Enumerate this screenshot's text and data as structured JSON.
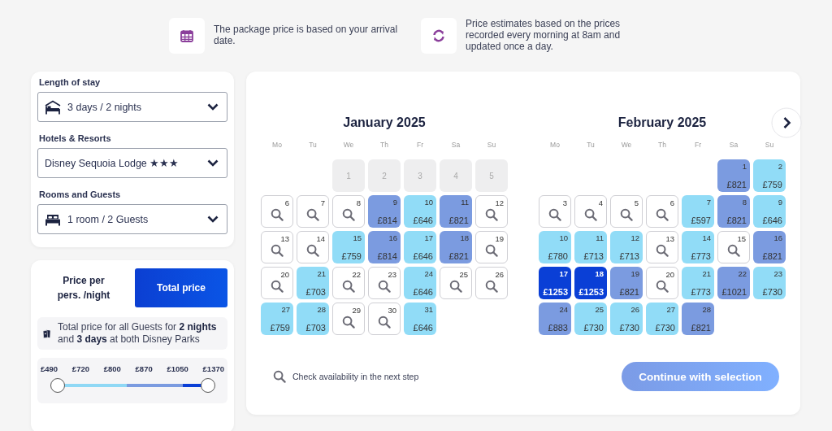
{
  "notes": [
    {
      "text": "The package price is based on your arrival date."
    },
    {
      "text": "Price estimates based on the prices recorded every morning at 8am and updated once a day."
    }
  ],
  "filters": [
    {
      "label": "Length of stay",
      "value": "3 days / 2 nights"
    },
    {
      "label": "Hotels & Resorts",
      "value": "Disney Sequoia Lodge ★★★"
    },
    {
      "label": "Rooms and Guests",
      "value": "1 room / 2 Guests"
    }
  ],
  "price_mode": [
    {
      "label": "Price per pers. /night",
      "selected": false
    },
    {
      "label": "Total price",
      "selected": true
    }
  ],
  "price_note": "Total price for all Guests for **2 nights** and **3 days** at both Disney Parks",
  "price_filter": {
    "labels": [
      "£490",
      "£720",
      "£800",
      "£870",
      "£1050",
      "£1370"
    ],
    "thumbs": [
      {
        "level": 0
      },
      {
        "level": 1
      }
    ]
  },
  "months": [
    {
      "title": "January 2025",
      "weekdays": [
        "Mo",
        "Tu",
        "We",
        "Th",
        "Fr",
        "Sa",
        "Su"
      ],
      "weeks": [
        [
          {
            "day": "1",
            "kind": "past"
          },
          {
            "day": "2",
            "kind": "past"
          },
          {
            "day": "3",
            "kind": "past"
          },
          {
            "day": "4",
            "kind": "past"
          },
          {
            "day": "5",
            "kind": "past"
          }
        ],
        [
          {
            "day": "6",
            "kind": "check"
          },
          {
            "day": "7",
            "kind": "check"
          },
          {
            "day": "8",
            "kind": "check"
          },
          {
            "day": "9",
            "kind": "priced",
            "color": "#7b9be0",
            "price": "£814"
          },
          {
            "day": "10",
            "kind": "priced",
            "color": "#91dcf7",
            "price": "£646"
          },
          {
            "day": "11",
            "kind": "priced",
            "color": "#7b9be0",
            "price": "£821"
          },
          {
            "day": "12",
            "kind": "check"
          }
        ],
        [
          {
            "day": "13",
            "kind": "check"
          },
          {
            "day": "14",
            "kind": "check"
          },
          {
            "day": "15",
            "kind": "priced",
            "color": "#91dcf7",
            "price": "£759"
          },
          {
            "day": "16",
            "kind": "priced",
            "color": "#7b9be0",
            "price": "£814"
          },
          {
            "day": "17",
            "kind": "priced",
            "color": "#91dcf7",
            "price": "£646"
          },
          {
            "day": "18",
            "kind": "priced",
            "color": "#7b9be0",
            "price": "£821"
          },
          {
            "day": "19",
            "kind": "check"
          }
        ],
        [
          {
            "day": "20",
            "kind": "check"
          },
          {
            "day": "21",
            "kind": "priced",
            "color": "#91dcf7",
            "price": "£703"
          },
          {
            "day": "22",
            "kind": "check"
          },
          {
            "day": "23",
            "kind": "check"
          },
          {
            "day": "24",
            "kind": "priced",
            "color": "#91dcf7",
            "price": "£646"
          },
          {
            "day": "25",
            "kind": "check"
          },
          {
            "day": "26",
            "kind": "check"
          }
        ],
        [
          {
            "day": "27",
            "kind": "priced",
            "color": "#91dcf7",
            "price": "£759"
          },
          {
            "day": "28",
            "kind": "priced",
            "color": "#91dcf7",
            "price": "£703"
          },
          {
            "day": "29",
            "kind": "check"
          },
          {
            "day": "30",
            "kind": "check"
          },
          {
            "day": "31",
            "kind": "priced",
            "color": "#91dcf7",
            "price": "£646"
          }
        ]
      ]
    },
    {
      "title": "February 2025",
      "weekdays": [
        "Mo",
        "Tu",
        "We",
        "Th",
        "Fr",
        "Sa",
        "Su"
      ],
      "weeks": [
        [
          {
            "day": "1",
            "kind": "priced",
            "color": "#7b9be0",
            "price": "£821"
          },
          {
            "day": "2",
            "kind": "priced",
            "color": "#91dcf7",
            "price": "£759"
          }
        ],
        [
          {
            "day": "3",
            "kind": "check"
          },
          {
            "day": "4",
            "kind": "check"
          },
          {
            "day": "5",
            "kind": "check"
          },
          {
            "day": "6",
            "kind": "check"
          },
          {
            "day": "7",
            "kind": "priced",
            "color": "#91dcf7",
            "price": "£597"
          },
          {
            "day": "8",
            "kind": "priced",
            "color": "#7b9be0",
            "price": "£821"
          },
          {
            "day": "9",
            "kind": "priced",
            "color": "#91dcf7",
            "price": "£646"
          }
        ],
        [
          {
            "day": "10",
            "kind": "priced",
            "color": "#91dcf7",
            "price": "£780"
          },
          {
            "day": "11",
            "kind": "priced",
            "color": "#91dcf7",
            "price": "£713"
          },
          {
            "day": "12",
            "kind": "priced",
            "color": "#91dcf7",
            "price": "£713"
          },
          {
            "day": "13",
            "kind": "check"
          },
          {
            "day": "14",
            "kind": "priced",
            "color": "#91dcf7",
            "price": "£773"
          },
          {
            "day": "15",
            "kind": "check"
          },
          {
            "day": "16",
            "kind": "priced",
            "color": "#7b9be0",
            "price": "£821"
          }
        ],
        [
          {
            "day": "17",
            "kind": "priced",
            "color": "#0a3fd6",
            "price": "£1253"
          },
          {
            "day": "18",
            "kind": "priced",
            "color": "#0a3fd6",
            "price": "£1253"
          },
          {
            "day": "19",
            "kind": "priced",
            "color": "#7b9be0",
            "price": "£821"
          },
          {
            "day": "20",
            "kind": "check"
          },
          {
            "day": "21",
            "kind": "priced",
            "color": "#91dcf7",
            "price": "£773"
          },
          {
            "day": "22",
            "kind": "priced",
            "color": "#7b9be0",
            "price": "£1021"
          },
          {
            "day": "23",
            "kind": "priced",
            "color": "#91dcf7",
            "price": "£730"
          }
        ],
        [
          {
            "day": "24",
            "kind": "priced",
            "color": "#7b9be0",
            "price": "£883"
          },
          {
            "day": "25",
            "kind": "priced",
            "color": "#91dcf7",
            "price": "£730"
          },
          {
            "day": "26",
            "kind": "priced",
            "color": "#91dcf7",
            "price": "£730"
          },
          {
            "day": "27",
            "kind": "priced",
            "color": "#91dcf7",
            "price": "£730"
          },
          {
            "day": "28",
            "kind": "priced",
            "color": "#7b9be0",
            "price": "£821"
          }
        ]
      ]
    }
  ],
  "hint": "Check availability in the next step",
  "continue_button": {
    "label": "Continue with selection",
    "disabled": true
  }
}
